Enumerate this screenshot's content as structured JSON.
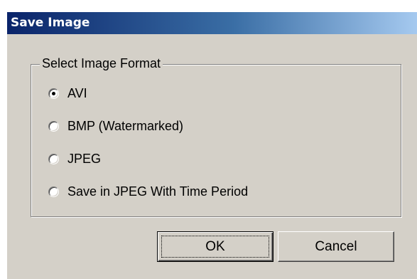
{
  "dialog": {
    "title": "Save Image"
  },
  "format_group": {
    "legend": "Select Image Format",
    "selected_index": 0,
    "options": [
      {
        "label": "AVI",
        "selected": true
      },
      {
        "label": "BMP (Watermarked)",
        "selected": false
      },
      {
        "label": "JPEG",
        "selected": false
      },
      {
        "label": "Save in JPEG With Time Period",
        "selected": false
      }
    ]
  },
  "buttons": {
    "ok_label": "OK",
    "cancel_label": "Cancel"
  },
  "colors": {
    "title_gradient_start": "#0a246a",
    "title_gradient_end": "#a6caf0",
    "dialog_face": "#d4d0c8"
  },
  "icons": {
    "selected_radio": "radio-selected-icon",
    "unselected_radio": "radio-unselected-icon"
  }
}
